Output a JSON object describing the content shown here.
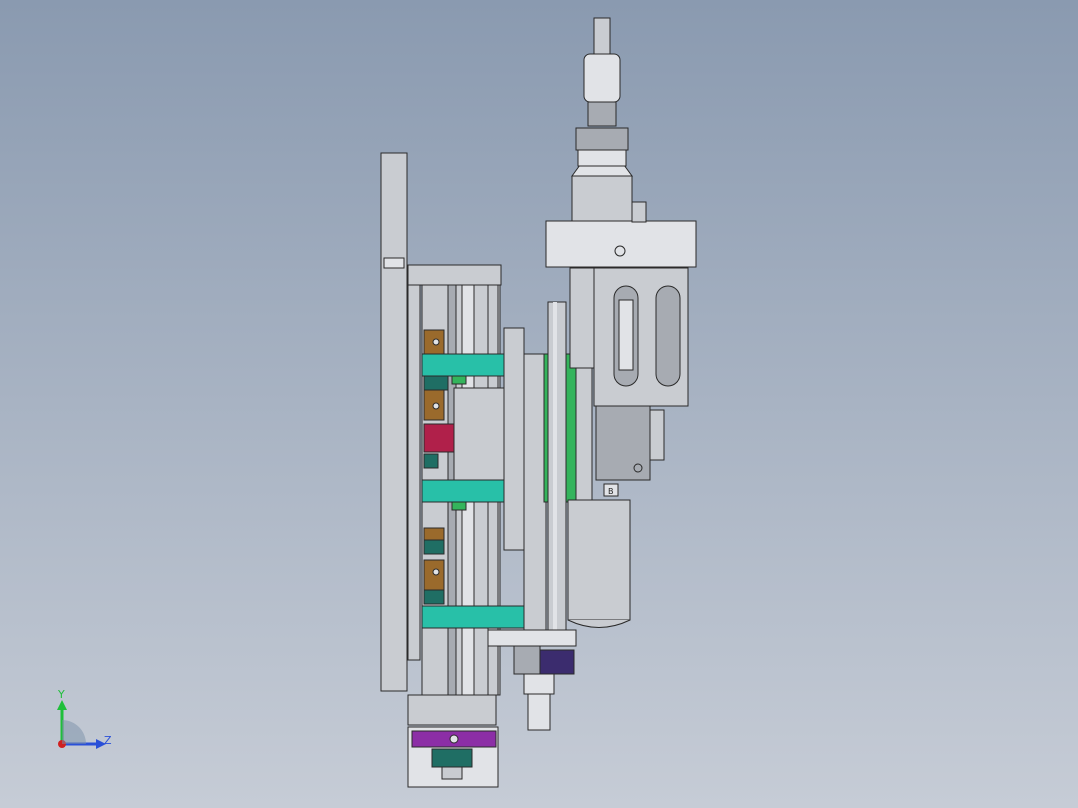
{
  "viewport": {
    "background_top": "#8a9ab0",
    "background_bottom": "#c6ccd6"
  },
  "triad": {
    "y_label": "Y",
    "z_label": "Z",
    "y_color": "#1fbf3a",
    "z_color": "#2a50d8",
    "x_color": "#d02020"
  },
  "part_colors": {
    "metal": "#c9ccd1",
    "metal_dark": "#a7abb2",
    "teal": "#28c0a8",
    "green": "#34b45c",
    "brown": "#9a6a2c",
    "purple": "#8c2ea6",
    "navy": "#3b2c6e",
    "crimson": "#b0204a",
    "dark_teal": "#1f6e64",
    "edge": "#2a2a2a"
  },
  "labels": {
    "small_tag": "B"
  }
}
